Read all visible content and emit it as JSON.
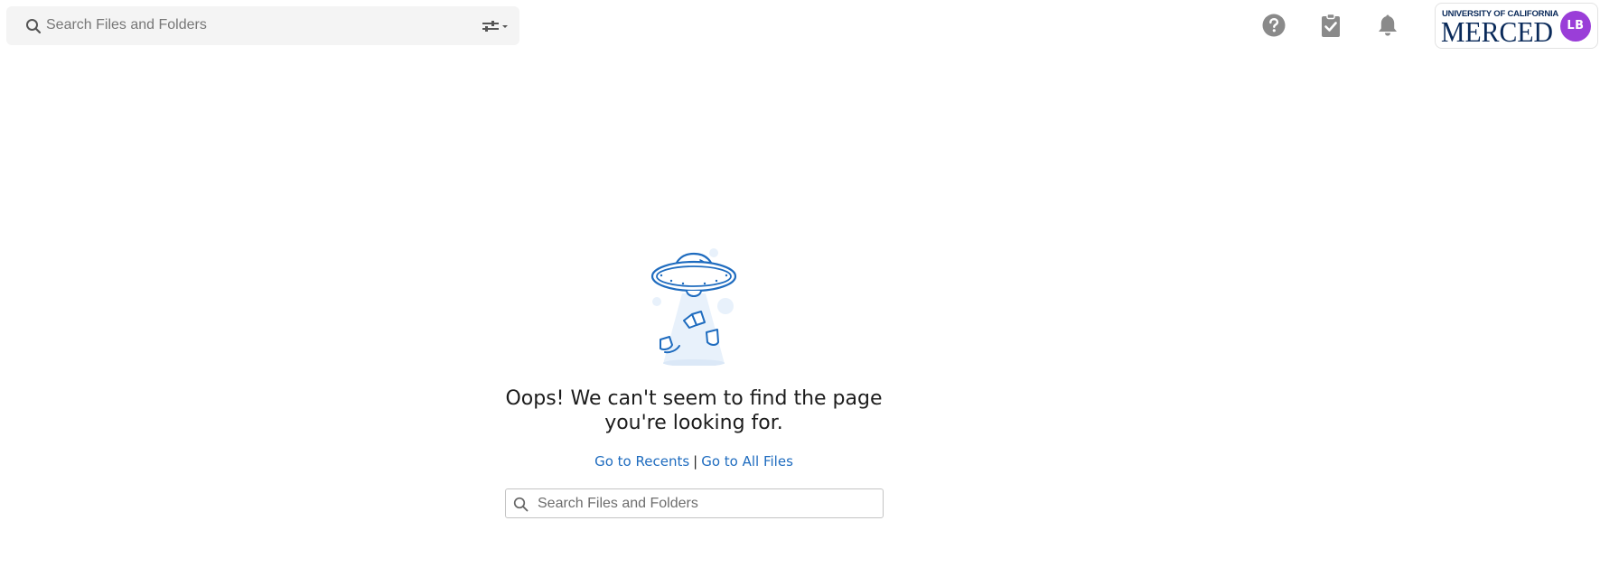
{
  "header": {
    "search": {
      "placeholder": "Search Files and Folders",
      "value": ""
    },
    "icons": {
      "help": "question-circle-icon",
      "tasks": "clipboard-check-icon",
      "notifications": "bell-icon"
    },
    "brand": {
      "logo_line1": "UNIVERSITY OF CALIFORNIA",
      "logo_line2": "MERCED",
      "avatar_initials": "LB"
    }
  },
  "main": {
    "message_line1": "Oops! We can't seem to find the page",
    "message_line2": "you're looking for.",
    "links": {
      "recents": "Go to Recents",
      "separator": "|",
      "all_files": "Go to All Files"
    },
    "search": {
      "placeholder": "Search Files and Folders",
      "value": ""
    }
  },
  "colors": {
    "link": "#1f6cbf",
    "avatar": "#9a3ed8",
    "icon": "#8a8a8a",
    "illustration": "#1f6cbf",
    "logo_text": "#0a2a5a"
  }
}
